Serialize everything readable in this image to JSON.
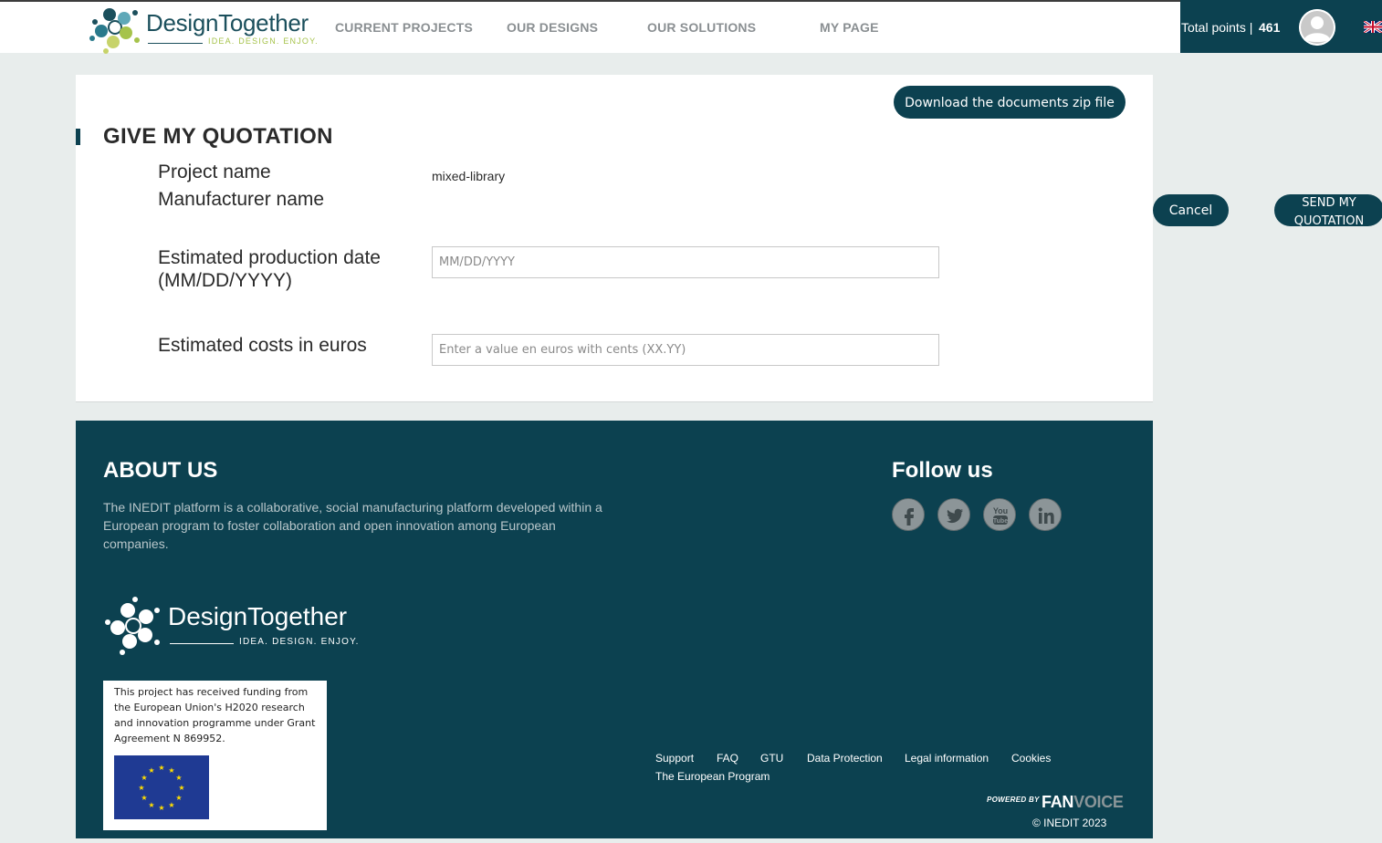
{
  "header": {
    "logo_word": "DesignTogether",
    "logo_tagline": "IDEA. DESIGN. ENJOY.",
    "nav": [
      "CURRENT PROJECTS",
      "OUR DESIGNS",
      "OUR SOLUTIONS",
      "MY PAGE"
    ],
    "points_label": "Total points |",
    "points_value": "461",
    "language_icon": "uk-flag-icon",
    "avatar_icon": "user-avatar-icon"
  },
  "main": {
    "download_button": "Download the documents zip file",
    "title": "GIVE MY QUOTATION",
    "project_name_label": "Project name",
    "project_name_value": "mixed-library",
    "manufacturer_name_label": "Manufacturer name",
    "production_date_label_1": "Estimated production date",
    "production_date_label_2": "(MM/DD/YYYY)",
    "production_date_placeholder": "MM/DD/YYYY",
    "costs_label": "Estimated costs in euros",
    "costs_placeholder": "Enter a value en euros with cents (XX.YY)",
    "cancel_button": "Cancel",
    "send_button_line1": "SEND MY",
    "send_button_line2": "QUOTATION"
  },
  "footer": {
    "about_title": "ABOUT US",
    "about_text": "The INEDIT platform is a collaborative, social manufacturing platform developed within a European program to foster collaboration and open innovation among European companies.",
    "follow_title": "Follow us",
    "social_icons": [
      "facebook-icon",
      "twitter-icon",
      "youtube-icon",
      "linkedin-icon"
    ],
    "logo_word": "DesignTogether",
    "logo_tagline": "IDEA. DESIGN. ENJOY.",
    "funding_text": "This project has received funding from the European Union's H2020 research and innovation programme under Grant Agreement N 869952.",
    "links": [
      "Support",
      "FAQ",
      "GTU",
      "Data Protection",
      "Legal information",
      "Cookies",
      "The European Program"
    ],
    "powered_by": "POWERED BY",
    "fan": "FAN",
    "voice": "VOICE",
    "copyright": "© INEDIT 2023"
  },
  "colors": {
    "brand_dark": "#0c4150",
    "accent_green": "#a6c34b",
    "page_bg": "#e8edec"
  }
}
